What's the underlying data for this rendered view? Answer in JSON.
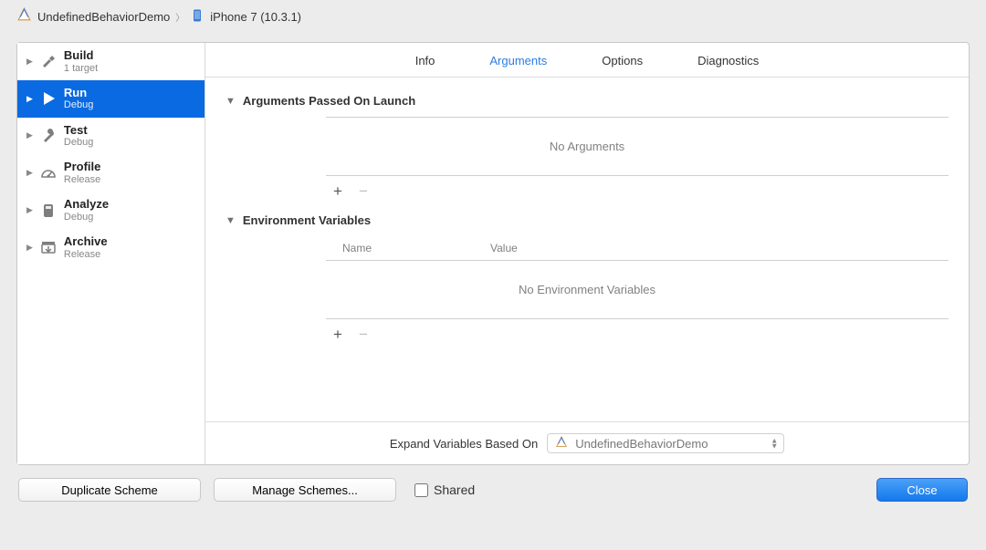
{
  "breadcrumb": {
    "project": "UndefinedBehaviorDemo",
    "device": "iPhone 7 (10.3.1)"
  },
  "sidebar": {
    "items": [
      {
        "title": "Build",
        "sub": "1 target"
      },
      {
        "title": "Run",
        "sub": "Debug"
      },
      {
        "title": "Test",
        "sub": "Debug"
      },
      {
        "title": "Profile",
        "sub": "Release"
      },
      {
        "title": "Analyze",
        "sub": "Debug"
      },
      {
        "title": "Archive",
        "sub": "Release"
      }
    ],
    "selected_index": 1
  },
  "tabs": {
    "items": [
      "Info",
      "Arguments",
      "Options",
      "Diagnostics"
    ],
    "selected_index": 1
  },
  "sections": {
    "args": {
      "title": "Arguments Passed On Launch",
      "empty": "No Arguments"
    },
    "env": {
      "title": "Environment Variables",
      "col_name": "Name",
      "col_value": "Value",
      "empty": "No Environment Variables"
    }
  },
  "footer": {
    "label": "Expand Variables Based On",
    "popup_value": "UndefinedBehaviorDemo"
  },
  "buttons": {
    "duplicate": "Duplicate Scheme",
    "manage": "Manage Schemes...",
    "shared": "Shared",
    "close": "Close"
  },
  "icons": {
    "add": "+",
    "remove": "−"
  }
}
